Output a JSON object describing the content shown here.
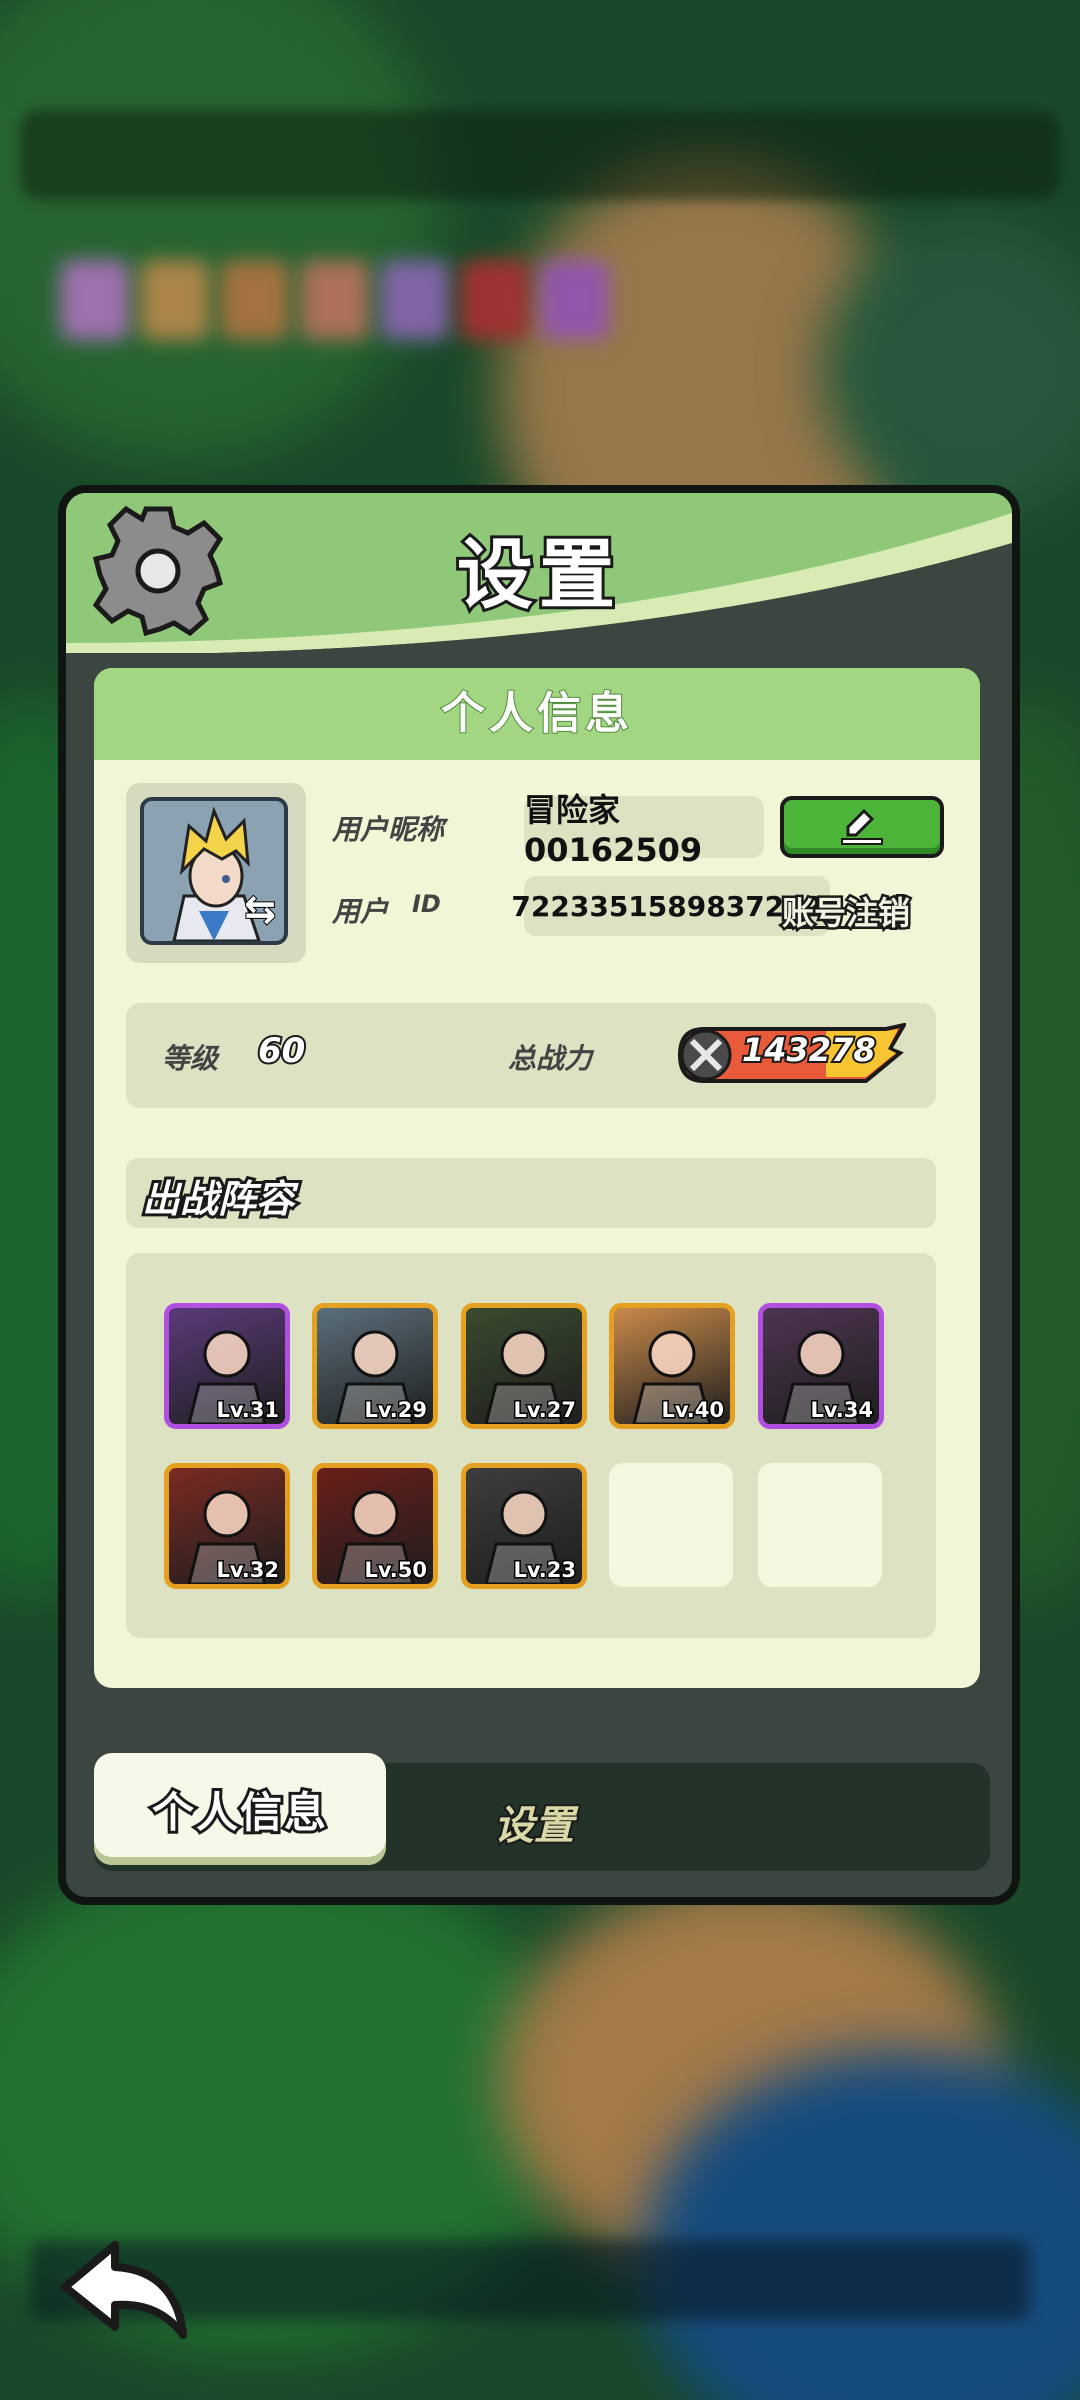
{
  "panel": {
    "title": "设置"
  },
  "profile_section": {
    "header": "个人信息",
    "nickname_label": "用户昵称",
    "nickname_value": "冒险家00162509",
    "id_label": "用户",
    "id_suffix": "ID",
    "id_value": "72233515898372127",
    "edit_button": "pencil-edit",
    "cancel_account": "账号注销",
    "level_label": "等级",
    "level_value": "60",
    "power_label": "总战力",
    "power_value": "143278"
  },
  "lineup": {
    "title": "出战阵容",
    "heroes": [
      {
        "level": "Lv.31",
        "rarity": "purple",
        "color": "#5a3a7a"
      },
      {
        "level": "Lv.29",
        "rarity": "orange",
        "color": "#5b6f7a"
      },
      {
        "level": "Lv.27",
        "rarity": "orange",
        "color": "#3a4a2e"
      },
      {
        "level": "Lv.40",
        "rarity": "orange",
        "color": "#c98a4a"
      },
      {
        "level": "Lv.34",
        "rarity": "purple",
        "color": "#4d3550"
      },
      {
        "level": "Lv.32",
        "rarity": "orange",
        "color": "#7a2a22"
      },
      {
        "level": "Lv.50",
        "rarity": "orange",
        "color": "#6a1f1a"
      },
      {
        "level": "Lv.23",
        "rarity": "orange",
        "color": "#3d3d3d"
      }
    ],
    "empty_slots": 2
  },
  "tabs": {
    "active": "个人信息",
    "inactive": "设置"
  },
  "colors": {
    "panel_green": "#8fc878",
    "content_bg": "#f0f6d6",
    "edit_green": "#4db43a",
    "border_orange": "#e5a021",
    "border_purple": "#b04fe0"
  }
}
